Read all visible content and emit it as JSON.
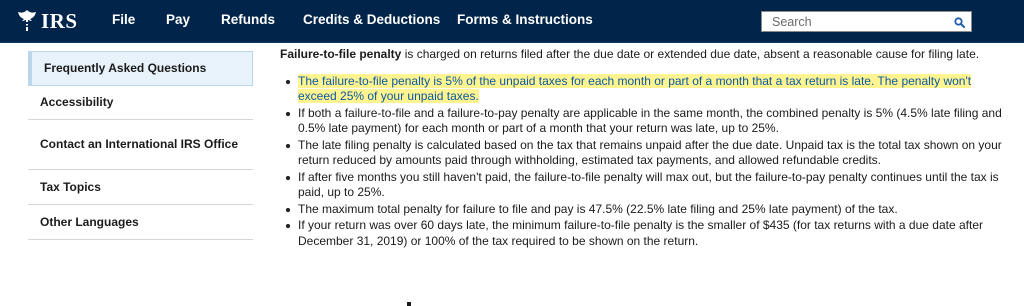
{
  "header": {
    "logo_text": "IRS",
    "nav": [
      {
        "label": "File"
      },
      {
        "label": "Pay"
      },
      {
        "label": "Refunds"
      },
      {
        "label": "Credits & Deductions"
      },
      {
        "label": "Forms & Instructions"
      }
    ],
    "search": {
      "placeholder": "Search",
      "value": ""
    },
    "colors": {
      "background": "#00244a",
      "text": "#ffffff"
    }
  },
  "sidebar": {
    "items": [
      {
        "label": "Frequently Asked Questions",
        "active": true
      },
      {
        "label": "Accessibility"
      },
      {
        "label": "Contact an International IRS Office"
      },
      {
        "label": "Tax Topics"
      },
      {
        "label": "Other Languages"
      }
    ]
  },
  "main": {
    "intro_bold": "Failure-to-file penalty",
    "intro_rest": " is charged on returns filed after the due date or extended due date, absent a reasonable cause for filing late.",
    "bullets": [
      {
        "text": "The failure-to-file penalty is 5% of the unpaid taxes for each month or part of a month that a tax return is late. The penalty won't exceed 25% of your unpaid taxes.",
        "highlighted": true
      },
      {
        "text": "If both a failure-to-file and a failure-to-pay penalty are applicable in the same month, the combined penalty is 5% (4.5% late filing and 0.5% late payment) for each month or part of a month that your return was late, up to 25%."
      },
      {
        "text": "The late filing penalty is calculated based on the tax that remains unpaid after the due date. Unpaid tax is the total tax shown on your return reduced by amounts paid through withholding, estimated tax payments, and allowed refundable credits."
      },
      {
        "text": "If after five months you still haven't paid, the failure-to-file penalty will max out, but the failure-to-pay penalty continues until the tax is paid, up to 25%."
      },
      {
        "text": "The maximum total penalty for failure to file and pay is 47.5% (22.5% late filing and 25% late payment) of the tax."
      },
      {
        "text": "If your return was over 60 days late, the minimum failure-to-file penalty is the smaller of $435 (for tax returns with a due date after December 31, 2019) or 100% of the tax required to be shown on the return."
      }
    ],
    "highlight_color": "#fff48f",
    "link_color": "#0a58a6"
  }
}
